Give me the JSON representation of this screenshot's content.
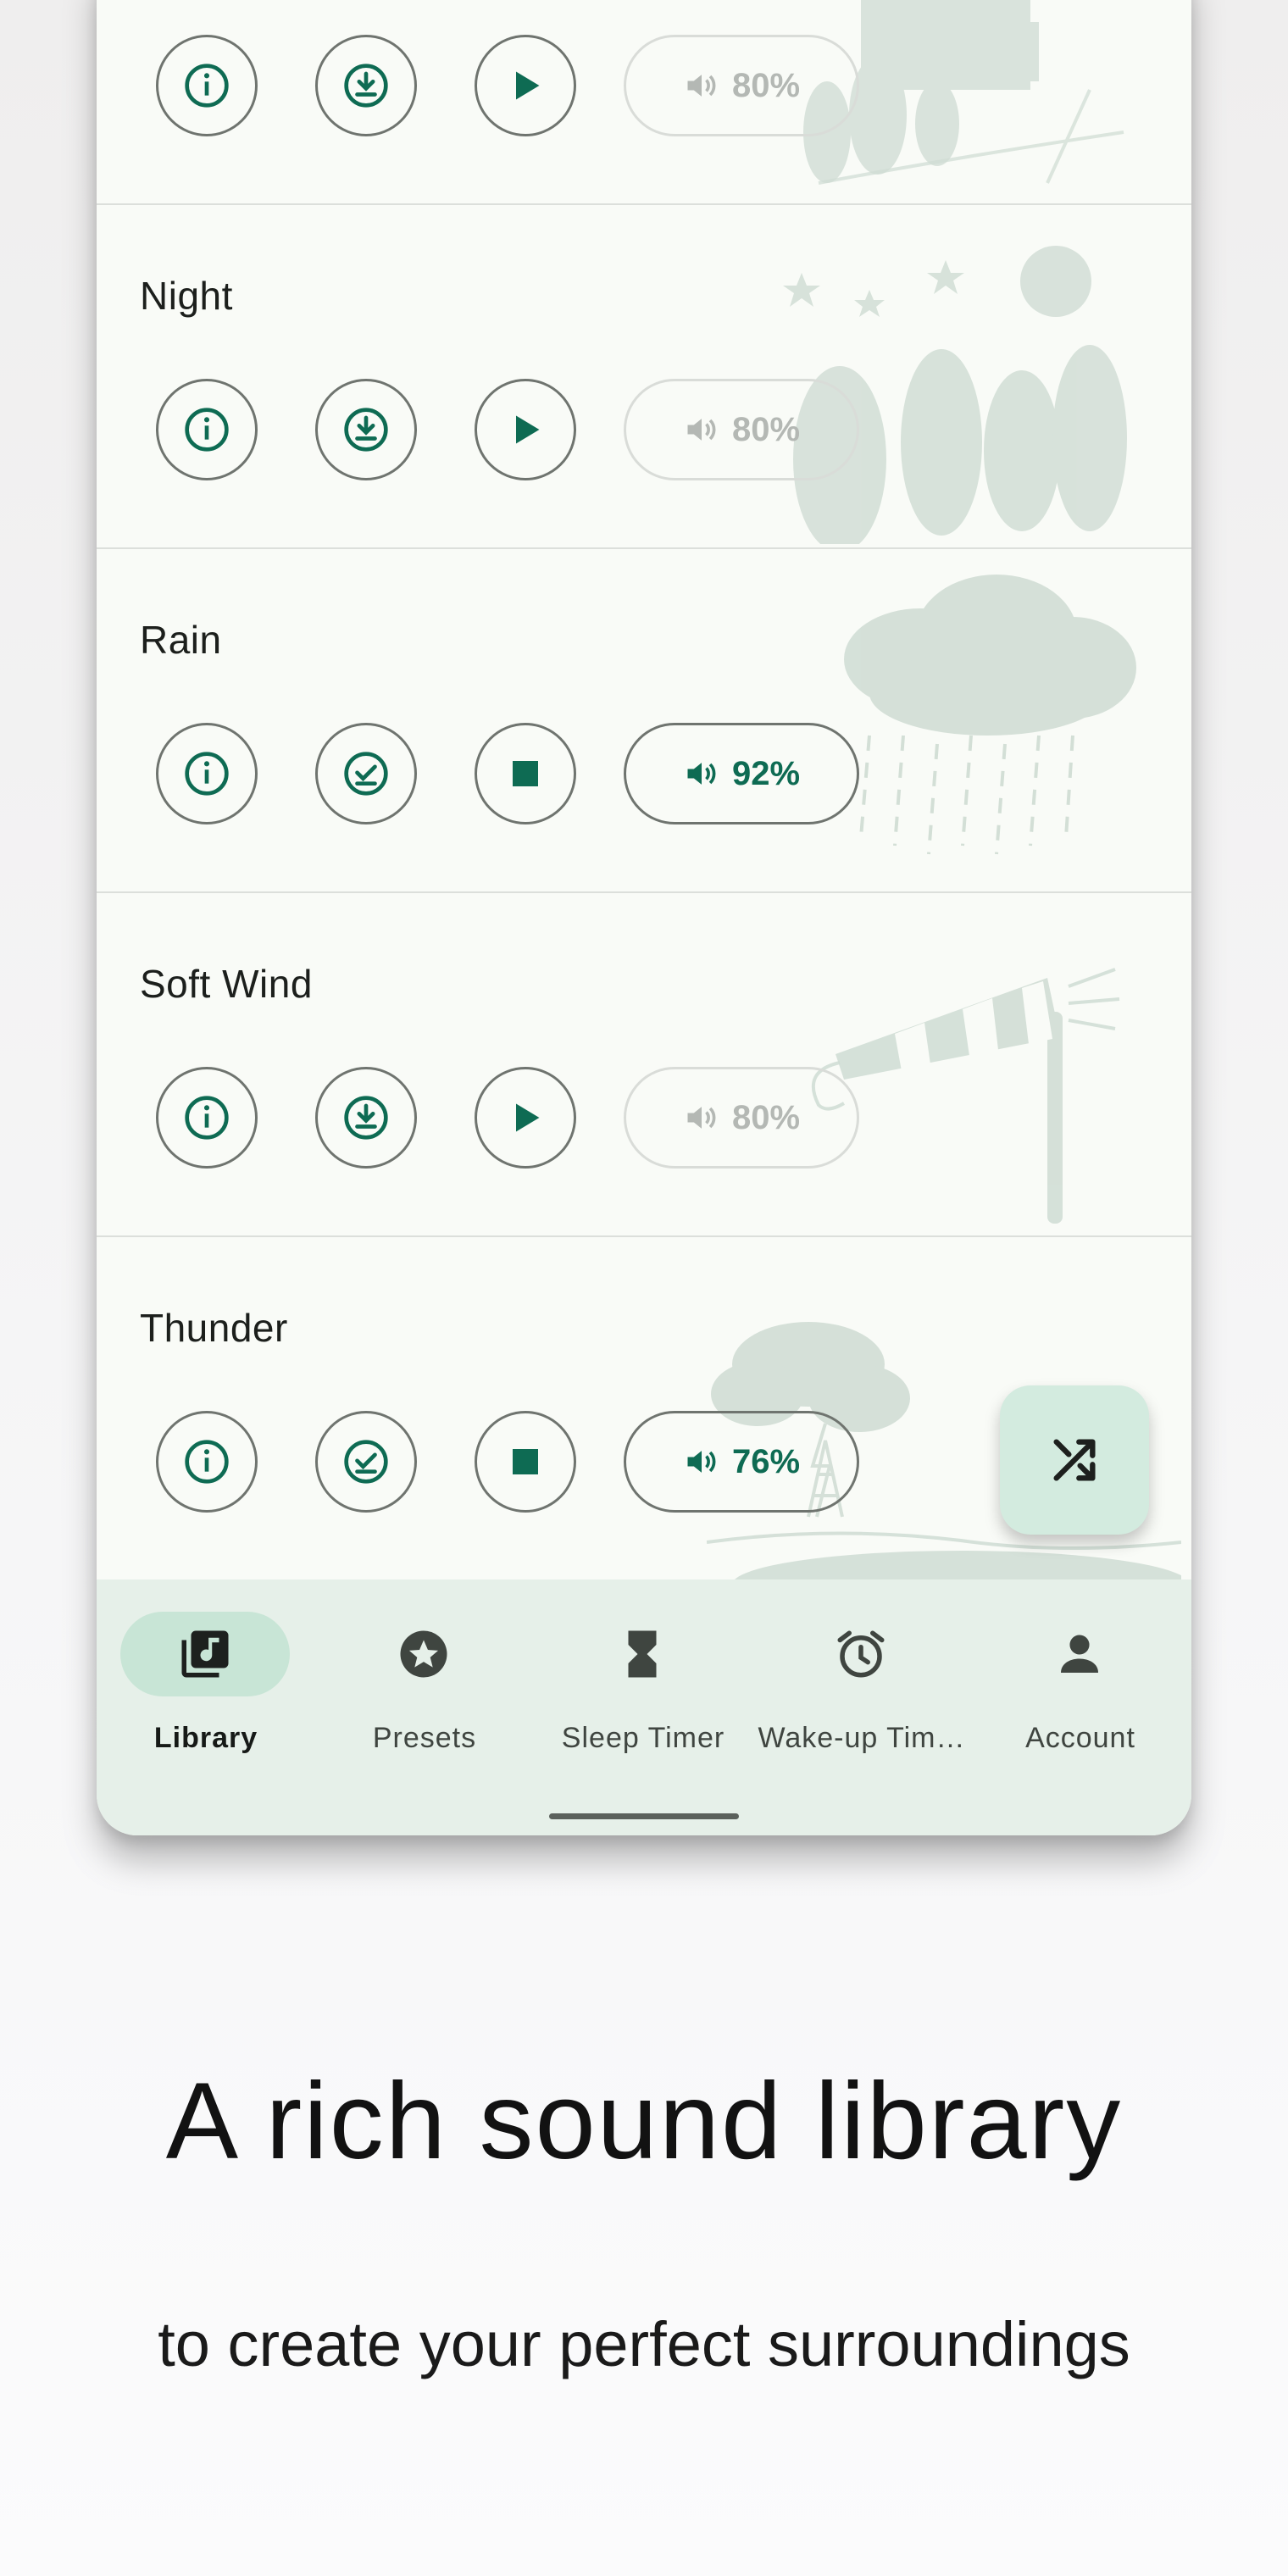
{
  "colors": {
    "accent": "#0e6b53",
    "card_bg": "#f9fbf7",
    "nav_bg": "#e6f0e9",
    "nav_active_pill": "#c8e5d6",
    "fab_bg": "#d3ebdf",
    "art": "#cfdcd3"
  },
  "sounds": [
    {
      "name": "",
      "download_state": "download",
      "playing": false,
      "volume": "80%",
      "art": "village-art"
    },
    {
      "name": "Night",
      "download_state": "download",
      "playing": false,
      "volume": "80%",
      "art": "night-trees-art"
    },
    {
      "name": "Rain",
      "download_state": "downloaded",
      "playing": true,
      "volume": "92%",
      "art": "rain-cloud-art"
    },
    {
      "name": "Soft Wind",
      "download_state": "download",
      "playing": false,
      "volume": "80%",
      "art": "windsock-art"
    },
    {
      "name": "Thunder",
      "download_state": "downloaded",
      "playing": true,
      "volume": "76%",
      "art": "thunder-tree-art"
    }
  ],
  "fab": {
    "icon": "shuffle-icon"
  },
  "nav": [
    {
      "label": "Library",
      "icon": "library-music-icon",
      "active": true
    },
    {
      "label": "Presets",
      "icon": "star-circle-icon",
      "active": false
    },
    {
      "label": "Sleep Timer",
      "icon": "hourglass-icon",
      "active": false
    },
    {
      "label": "Wake-up Tim…",
      "icon": "alarm-clock-icon",
      "active": false
    },
    {
      "label": "Account",
      "icon": "person-icon",
      "active": false
    }
  ],
  "promo": {
    "headline": "A rich sound library",
    "subline": "to create your perfect surroundings"
  }
}
